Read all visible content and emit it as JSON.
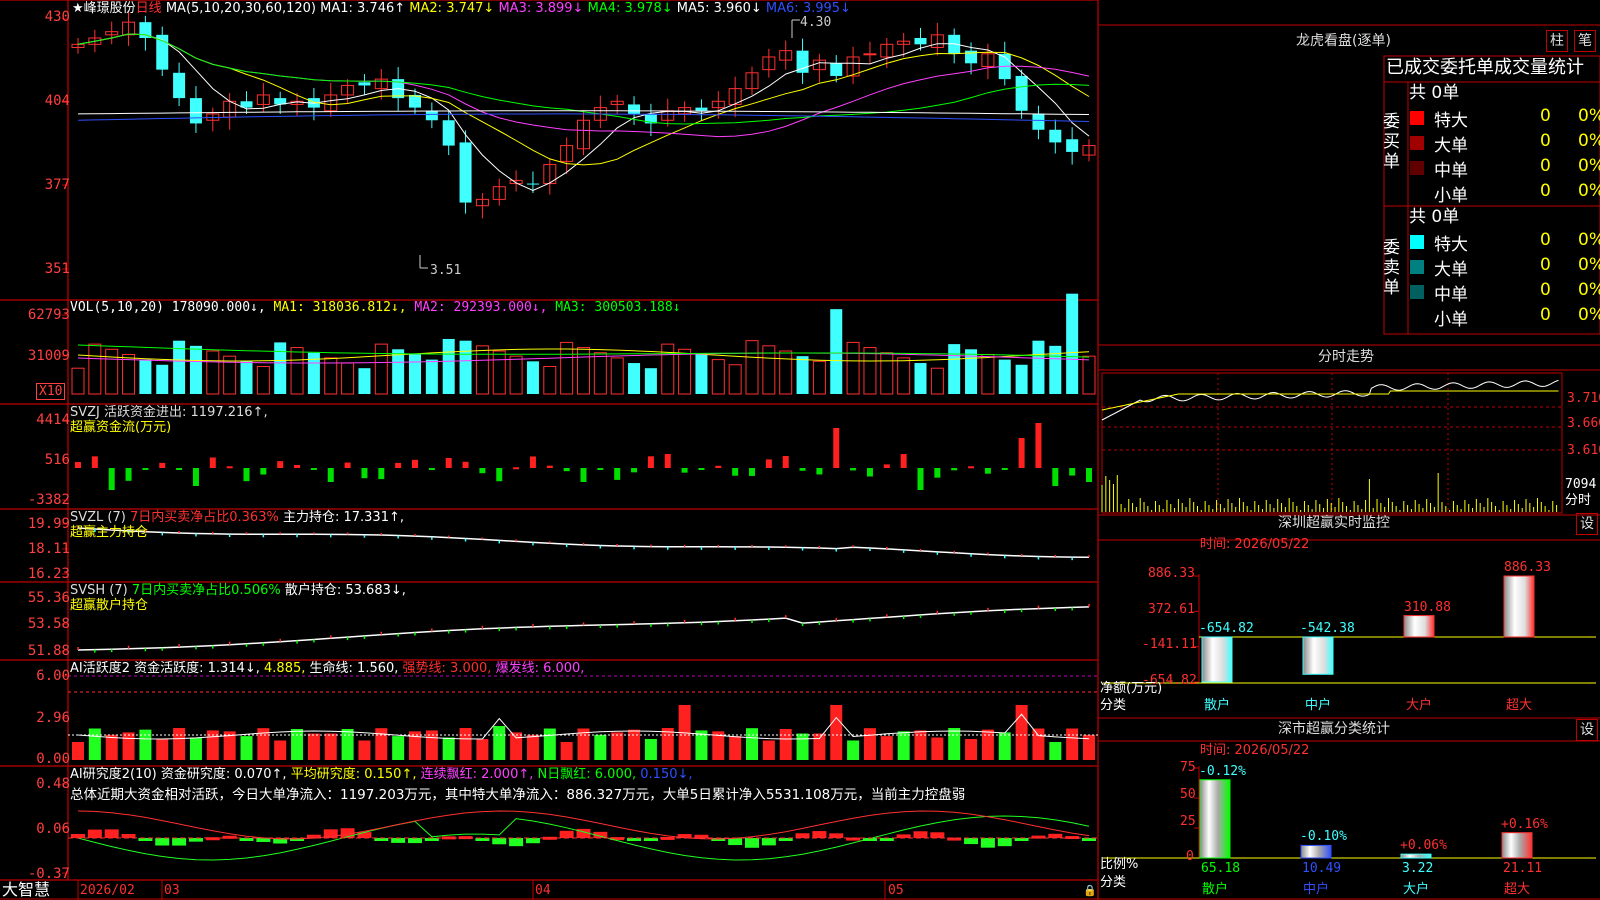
{
  "stock": {
    "star": "★",
    "name": "峰璟股份",
    "period": "日线"
  },
  "main_axis": [
    "430",
    "404",
    "377",
    "351"
  ],
  "ma_legend": {
    "params": "MA(5,10,20,30,60,120)",
    "ma1": "MA1: 3.746↑",
    "ma2": "MA2: 3.747↓",
    "ma3": "MA3: 3.899↓",
    "ma4": "MA4: 3.978↓",
    "ma5": "MA5: 3.960↓",
    "ma6": "MA6: 3.995↓"
  },
  "annot": {
    "high": "4.30",
    "low": "3.51"
  },
  "vol": {
    "params": "VOL(5,10,20)",
    "value": "178090.000↓,",
    "ma1": "MA1: 318036.812↓,",
    "ma2": "MA2: 292393.000↓,",
    "ma3": "MA3: 300503.188↓",
    "axis": [
      "62793",
      "31009"
    ],
    "unit": "X10"
  },
  "svzj": {
    "title": "SVZJ  活跃资金进出: 1197.216↑,",
    "sub": "超赢资金流(万元)",
    "axis": [
      "4414",
      "516",
      "-3382"
    ]
  },
  "svzl": {
    "title1": "SVZL (7)",
    "title2": "7日内买卖净占比0.363%",
    "title3": "主力持仓: 17.331↑,",
    "sub": "超赢主力持仓",
    "axis": [
      "19.99",
      "18.11",
      "16.23"
    ]
  },
  "svsh": {
    "title1": "SVSH (7)",
    "title2": "7日内买卖净占比0.506%",
    "title3": "散户持仓: 53.683↓,",
    "sub": "超赢散户持仓",
    "axis": [
      "55.36",
      "53.58",
      "51.88"
    ]
  },
  "ai1": {
    "t1": "AI活跃度2 资金活跃度: 1.314↓,",
    "t2": "4.885,",
    "t3": "生命线: 1.560,",
    "t4": "强势线: 3.000,",
    "t5": "爆发线: 6.000,",
    "axis": [
      "6.00",
      "2.96",
      "0.00"
    ]
  },
  "ai2": {
    "t1": "AI研究度2(10) 资金研究度: 0.070↑,",
    "t2": "平均研究度: 0.150↑,",
    "t3": "连续飘红: 2.000↑,",
    "t4": "N日飘红: 6.000,",
    "t5": "0.150↓,",
    "summary": "总体近期大资金相对活跃，今日大单净流入：1197.203万元，其中特大单净流入：886.327万元，大单5日累计净入5531.108万元，当前主力控盘弱",
    "axis": [
      "0.48",
      "0.06",
      "-0.37"
    ]
  },
  "bottom": {
    "brand": "大智慧",
    "dates": [
      "2026/02",
      "03",
      "04",
      "05"
    ]
  },
  "right": {
    "lhb_title": "龙虎看盘(逐单)",
    "btn1": "柱",
    "btn2": "笔",
    "table_header": "已成交委托单成交量统计",
    "buy": {
      "label": "委买单",
      "total": "共 0单",
      "rows": [
        {
          "name": "特大",
          "v": "0",
          "p": "0%",
          "color": "#ff0000"
        },
        {
          "name": "大单",
          "v": "0",
          "p": "0%",
          "color": "#a00000"
        },
        {
          "name": "中单",
          "v": "0",
          "p": "0%",
          "color": "#600000"
        },
        {
          "name": "小单",
          "v": "0",
          "p": "0%",
          "color": ""
        }
      ]
    },
    "sell": {
      "label": "委卖单",
      "total": "共 0单",
      "rows": [
        {
          "name": "特大",
          "v": "0",
          "p": "0%",
          "color": "#00ffff"
        },
        {
          "name": "大单",
          "v": "0",
          "p": "0%",
          "color": "#008080"
        },
        {
          "name": "中单",
          "v": "0",
          "p": "0%",
          "color": "#006060"
        },
        {
          "name": "小单",
          "v": "0",
          "p": "0%",
          "color": ""
        }
      ]
    },
    "fs_title": "分时走势",
    "fs_axis": [
      "3.710",
      "3.660",
      "3.610",
      "7094",
      "分时"
    ],
    "sz_title": "深圳超赢实时监控",
    "sz_btn": "设",
    "sz_time": "时间: 2026/05/22",
    "sz_axis": [
      "886.33",
      "372.61",
      "-141.11",
      "-654.82"
    ],
    "sz_ylabel": "净额(万元)",
    "sz_xlabel": "分类",
    "sz_cats": [
      "散户",
      "中户",
      "大户",
      "超大"
    ],
    "sz_labels": [
      "-654.82",
      "-542.38",
      "310.88",
      "886.33"
    ],
    "fl_title": "深市超赢分类统计",
    "fl_btn": "设",
    "fl_time": "时间: 2026/05/22",
    "fl_axis": [
      "75",
      "50",
      "25",
      "0"
    ],
    "fl_ylabel": "比例%",
    "fl_xlabel": "分类",
    "fl_cats": [
      "散户",
      "中户",
      "大户",
      "超大"
    ],
    "fl_top": [
      "-0.12%",
      "-0.10%",
      "+0.06%",
      "+0.16%"
    ],
    "fl_bottom": [
      "65.18",
      "10.49",
      "3.22",
      "21.11"
    ]
  },
  "chart_data": [
    {
      "type": "bar",
      "title": "深圳超赢实时监控",
      "categories": [
        "散户",
        "中户",
        "大户",
        "超大"
      ],
      "values": [
        -654.82,
        -542.38,
        310.88,
        886.33
      ],
      "ylabel": "净额(万元)",
      "xlabel": "分类",
      "ylim": [
        -654.82,
        886.33
      ]
    },
    {
      "type": "bar",
      "title": "深市超赢分类统计",
      "categories": [
        "散户",
        "中户",
        "大户",
        "超大"
      ],
      "values": [
        65.18,
        10.49,
        3.22,
        21.11
      ],
      "ylabel": "比例%",
      "xlabel": "分类",
      "ylim": [
        0,
        75
      ]
    }
  ]
}
